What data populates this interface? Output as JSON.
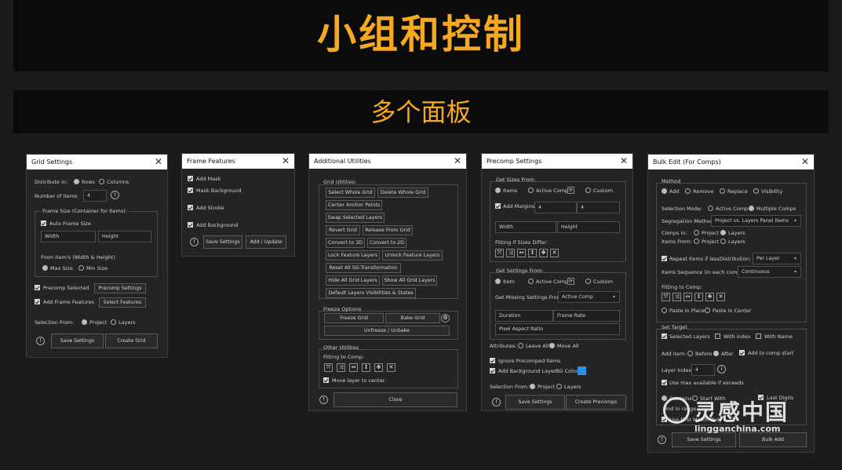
{
  "banner": {
    "title": "小组和控制"
  },
  "subtitle": "多个面板",
  "grid_settings": {
    "title": "Grid Settings",
    "distribute_in": "Distribute in:",
    "rows": "Rows",
    "columns": "Columns",
    "number_of_items_label": "Number of Items",
    "number_of_items": "4",
    "frame_size_legend": "Frame Size (Container for Items):",
    "auto_frame_size": "Auto Frame Size",
    "width": "Width",
    "height": "Height",
    "from_items": "From Item's (Width & Height)",
    "max_size": "Max Size",
    "min_size": "Min Size",
    "precomp_selected": "Precomp Selected",
    "precomp_settings": "Precomp Settings",
    "add_frame_features": "Add Frame Features",
    "select_features": "Select Features",
    "selection_from": "Selection From:",
    "project": "Project",
    "layers": "Layers",
    "save_settings": "Save Settings",
    "create_grid": "Create Grid"
  },
  "frame_features": {
    "title": "Frame Features",
    "add_mask": "Add Mask",
    "mask_background": "Mask Background",
    "add_stroke": "Add Stroke",
    "add_background": "Add Background",
    "save_settings": "Save Settings",
    "add_update": "Add / Update"
  },
  "additional_utilities": {
    "title": "Additional Utilities",
    "grid_utilities": "Grid Utilities:",
    "select_whole_grid": "Select Whole Grid",
    "delete_whole_grid": "Delete Whole Grid",
    "center_anchor_points": "Center Anchor Points",
    "swap_selected_layers": "Swap Selected Layers",
    "revert_grid": "Revert Grid",
    "release_from_grid": "Release From Grid",
    "convert_to_3d": "Convert to 3D",
    "convert_to_2d": "Convert to 2D",
    "lock_feature_layers": "Lock Feature Layers",
    "unlock_feature_layers": "Unlock Feature Layers",
    "reset_all_sg": "Reset All SG-Transformation",
    "hide_all_grid_layers": "Hide All Grid Layers",
    "show_all_grid_layers": "Show All Grid Layers",
    "default_layers_visibilities": "Default Layers Visibilities & States",
    "freeze_options": "Freeze Options",
    "freeze_grid": "Freeze Grid",
    "bake_grid": "Bake Grid",
    "unfreeze_unbake": "Unfreeze / Unbake",
    "other_utilities": "Other Utilities",
    "fitting_to_comp": "Fitting to Comp:",
    "move_layer_to_center": "Move layer to center.",
    "close": "Close"
  },
  "precomp_settings": {
    "title": "Precomp Settings",
    "get_sizes_from": "Get Sizes From:",
    "items": "Items",
    "active_comp": "Active Comp",
    "custom": "Custom",
    "add_margins": "Add Margins:",
    "margin_1": "4",
    "margin_2": "4",
    "width": "Width",
    "height": "Height",
    "fitting_if_sizes_differ": "Fitting If Sizes Differ:",
    "get_settings_from": "Get Settings From:",
    "item": "Item",
    "get_missing_settings_from": "Get Missing Settings From:",
    "missing_value": "Active Comp",
    "duration": "Duration",
    "frame_rate": "Frame Rate",
    "pixel_aspect_ratio": "Pixel Aspect Ratio",
    "attributes": "Attributes:",
    "leave_all": "Leave All",
    "move_all": "Move All",
    "ignore_precomped_items": "Ignore Precomped Items",
    "add_background_layer": "Add Background Layer",
    "bg_color": "BG Color",
    "bg_color_hex": "#2f8fe3",
    "selection_from": "Selection From:",
    "project": "Project",
    "layers": "Layers",
    "save_settings": "Save Settings",
    "create_precomps": "Create Precomps"
  },
  "bulk_edit": {
    "title": "Bulk Edit (For Comps)",
    "method": "Method",
    "add": "Add",
    "remove": "Remove",
    "replace": "Replace",
    "visibility": "Visibility",
    "selection_mode": "Selection Mode:",
    "active_comp": "Active Comp",
    "multiple_comps": "Multiple Comps",
    "segregation_method": "Segregation Method:",
    "segregation_value": "Project vs. Layers Panel Items",
    "comps_in": "Comps in:",
    "items_from": "Items From:",
    "project": "Project",
    "layers": "Layers",
    "repeat_items_if_less": "Repeat Items if less",
    "distribution": "Distribution:",
    "distribution_value": "Per Layer",
    "items_sequence": "Items Sequence (in each comp):",
    "sequence_value": "Continuous",
    "fitting_to_comp": "Fitting to Comp:",
    "paste_in_place": "Paste in Place",
    "paste_in_center": "Paste in Center",
    "set_target": "Set Target",
    "selected_layers": "Selected Layers",
    "with_index": "With index",
    "with_name": "With Name",
    "add_item": "Add item:",
    "before": "Before",
    "after": "After",
    "add_to_comp_start": "Add to comp start",
    "layer_index": "Layer Index",
    "layer_index_value": "4",
    "use_max_available": "Use max available if exceeds",
    "contains": "Contains",
    "start_with": "Start With",
    "last_digits": "Last Digits",
    "find_in_range": "Find in range",
    "use_first_match_only": "Use First Match Only",
    "save_settings": "Save Settings",
    "bulk_add": "Bulk Add"
  },
  "watermark": {
    "cn": "灵感中国",
    "en": "lingganchina.com"
  }
}
